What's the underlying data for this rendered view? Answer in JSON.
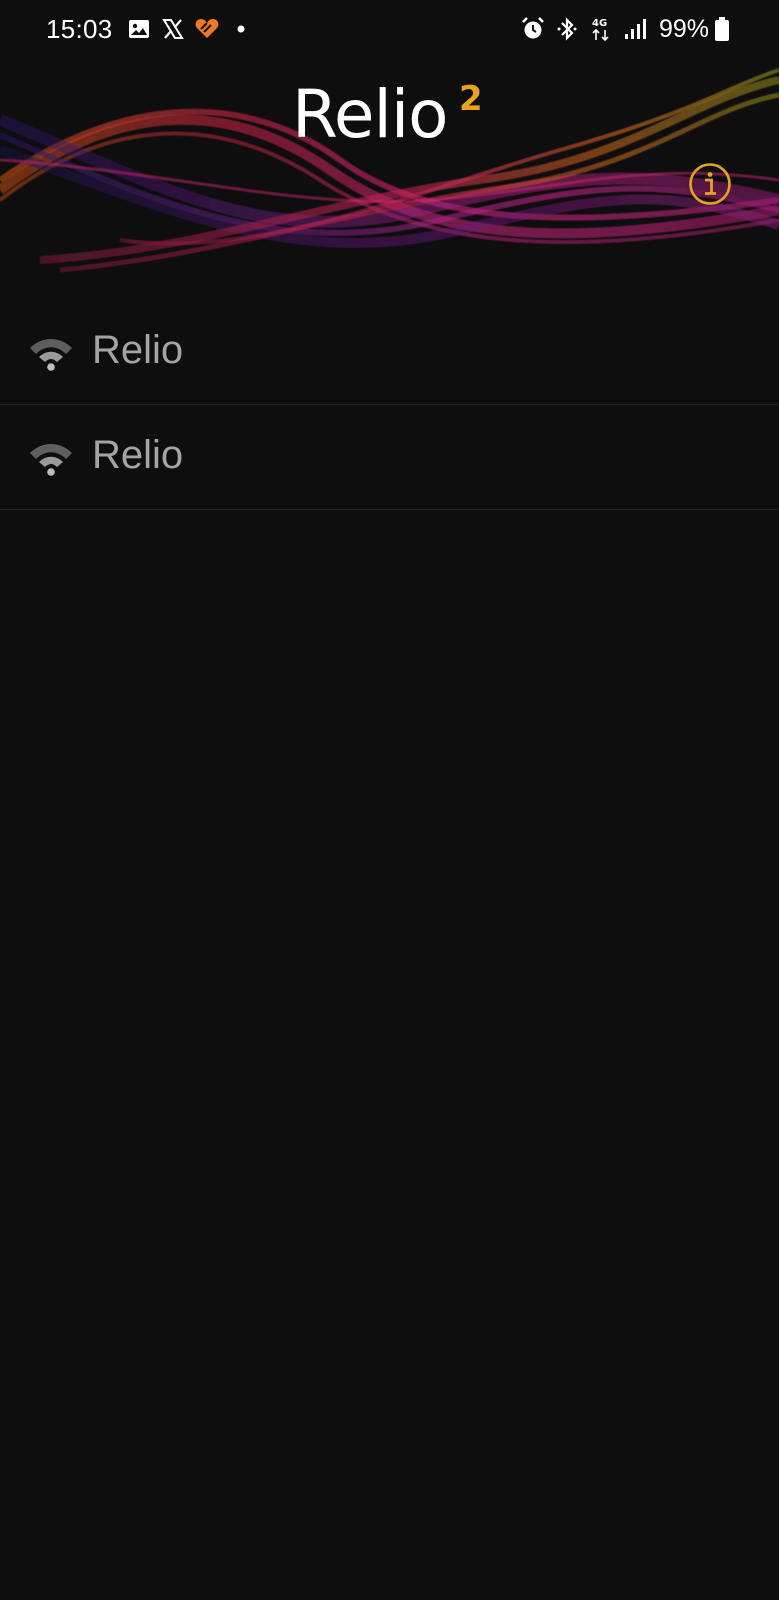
{
  "status_bar": {
    "time": "15:03",
    "left_icons": [
      "gallery-icon",
      "x-icon",
      "heart-app-icon",
      "dot-icon"
    ],
    "right_icons": [
      "alarm-icon",
      "bluetooth-icon",
      "4g-icon",
      "signal-icon",
      "battery-icon"
    ],
    "network_label": "4G",
    "battery_text": "99%"
  },
  "header": {
    "title": "Relio",
    "title_superscript": "2",
    "info_icon": "info-icon",
    "accent_color": "#e8a21b"
  },
  "devices": [
    {
      "name": "Relio",
      "icon": "wifi-icon"
    },
    {
      "name": "Relio",
      "icon": "wifi-icon"
    }
  ],
  "colors": {
    "background": "#0e0e0f",
    "label": "#a4a4a4",
    "divider": "#242426"
  }
}
